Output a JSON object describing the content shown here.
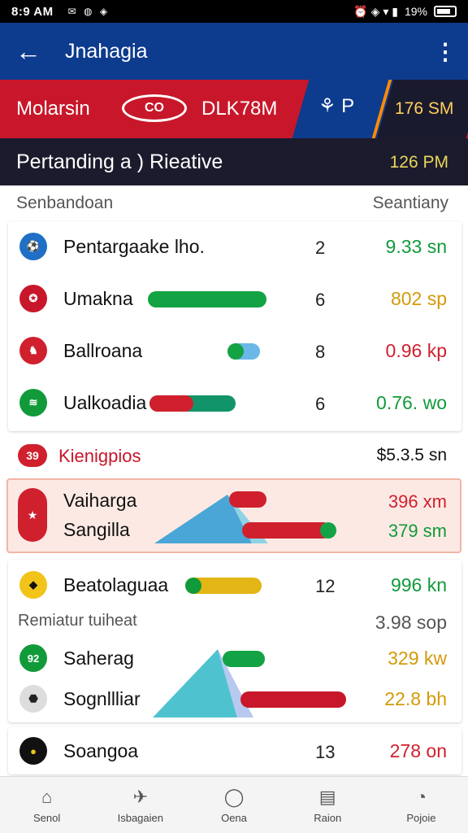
{
  "status": {
    "time": "8:9 AM",
    "notifications": "✉ ◍ ◈",
    "right_icons": "⏰ ◈ ▾ ▮",
    "battery": "19%"
  },
  "appbar": {
    "title": "Jnahagia"
  },
  "banner": {
    "left": "Molarsin",
    "logo": "CO",
    "mid": "DLK78M",
    "icon": "⚘ P",
    "right": "176 SM"
  },
  "sub": {
    "left": "Pertanding a ) Rieative",
    "right": "126 PM"
  },
  "list_header": {
    "left": "Senbandoan",
    "right": "Seantiany"
  },
  "rows1": [
    {
      "name": "Pentargaake lho.",
      "rank": "2",
      "value": "9.33 sn",
      "color": "green",
      "icon_color": "#1f6fc5",
      "icon": "⚽"
    },
    {
      "name": "Umakna",
      "rank": "6",
      "value": "802 sp",
      "color": "gold",
      "icon_color": "#c8172a",
      "icon": "✪",
      "bar": 0.62
    },
    {
      "name": "Ballroana",
      "rank": "8",
      "value": "0.96 kp",
      "color": "red",
      "icon_color": "#d0202e",
      "icon": "♞",
      "bar": 0.25
    },
    {
      "name": "Ualkoadia",
      "rank": "6",
      "value": "0.76. wo",
      "color": "green",
      "icon_color": "#119a3a",
      "icon": "≋",
      "bar": 0.45
    }
  ],
  "section": {
    "badge": "39",
    "title": "Kienigpios",
    "value": "$5.3.5 sn"
  },
  "highlight": {
    "top": {
      "name": "Vaiharga",
      "value": "396 xm",
      "color": "red"
    },
    "bottom": {
      "name": "Sangilla",
      "value": "379 sm",
      "color": "green"
    }
  },
  "group2": [
    {
      "name": "Beatolaguaa",
      "rank": "12",
      "value": "996 kn",
      "color": "green",
      "icon_color": "#f2c318",
      "icon": "◆"
    },
    {
      "name": "Remiatur tuiheat",
      "rank": "",
      "value": "3.98 sop",
      "color": "gray"
    },
    {
      "name": "Saherag",
      "rank": "",
      "value": "329 kw",
      "color": "gold",
      "icon_color": "#119a3a",
      "icon": "92"
    },
    {
      "name": "Sognllliar",
      "rank": "",
      "value": "22.8 bh",
      "color": "gold",
      "icon_color": "#dddddd",
      "icon": "⬣"
    }
  ],
  "last_row": {
    "name": "Soangoa",
    "rank": "13",
    "value": "278 on",
    "color": "red",
    "icon_color": "#111",
    "icon": "●"
  },
  "nav": [
    {
      "label": "Senol",
      "icon": "⌂"
    },
    {
      "label": "Isbagaien",
      "icon": "✈"
    },
    {
      "label": "Oena",
      "icon": "◯"
    },
    {
      "label": "Raion",
      "icon": "▤"
    },
    {
      "label": "Pojoie",
      "icon": "◔"
    }
  ]
}
